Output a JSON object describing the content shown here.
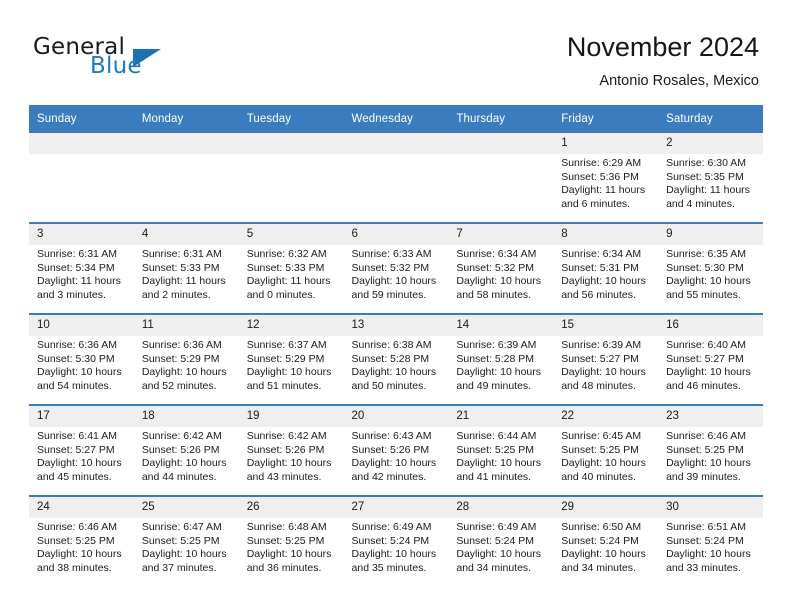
{
  "brand": {
    "word_one": "General",
    "word_two": "Blue",
    "logo_icon": "triangle-logo-icon"
  },
  "header": {
    "title": "November 2024",
    "subtitle": "Antonio Rosales, Mexico"
  },
  "calendar": {
    "weekday_headers": [
      "Sunday",
      "Monday",
      "Tuesday",
      "Wednesday",
      "Thursday",
      "Friday",
      "Saturday"
    ],
    "accent_color": "#3a7cbe",
    "daynum_band_color": "#efefef",
    "weeks": [
      [
        {
          "day": "",
          "empty": true,
          "lines": []
        },
        {
          "day": "",
          "empty": true,
          "lines": []
        },
        {
          "day": "",
          "empty": true,
          "lines": []
        },
        {
          "day": "",
          "empty": true,
          "lines": []
        },
        {
          "day": "",
          "empty": true,
          "lines": []
        },
        {
          "day": "1",
          "empty": false,
          "lines": [
            "Sunrise: 6:29 AM",
            "Sunset: 5:36 PM",
            "Daylight: 11 hours",
            "and 6 minutes."
          ]
        },
        {
          "day": "2",
          "empty": false,
          "lines": [
            "Sunrise: 6:30 AM",
            "Sunset: 5:35 PM",
            "Daylight: 11 hours",
            "and 4 minutes."
          ]
        }
      ],
      [
        {
          "day": "3",
          "empty": false,
          "lines": [
            "Sunrise: 6:31 AM",
            "Sunset: 5:34 PM",
            "Daylight: 11 hours",
            "and 3 minutes."
          ]
        },
        {
          "day": "4",
          "empty": false,
          "lines": [
            "Sunrise: 6:31 AM",
            "Sunset: 5:33 PM",
            "Daylight: 11 hours",
            "and 2 minutes."
          ]
        },
        {
          "day": "5",
          "empty": false,
          "lines": [
            "Sunrise: 6:32 AM",
            "Sunset: 5:33 PM",
            "Daylight: 11 hours",
            "and 0 minutes."
          ]
        },
        {
          "day": "6",
          "empty": false,
          "lines": [
            "Sunrise: 6:33 AM",
            "Sunset: 5:32 PM",
            "Daylight: 10 hours",
            "and 59 minutes."
          ]
        },
        {
          "day": "7",
          "empty": false,
          "lines": [
            "Sunrise: 6:34 AM",
            "Sunset: 5:32 PM",
            "Daylight: 10 hours",
            "and 58 minutes."
          ]
        },
        {
          "day": "8",
          "empty": false,
          "lines": [
            "Sunrise: 6:34 AM",
            "Sunset: 5:31 PM",
            "Daylight: 10 hours",
            "and 56 minutes."
          ]
        },
        {
          "day": "9",
          "empty": false,
          "lines": [
            "Sunrise: 6:35 AM",
            "Sunset: 5:30 PM",
            "Daylight: 10 hours",
            "and 55 minutes."
          ]
        }
      ],
      [
        {
          "day": "10",
          "empty": false,
          "lines": [
            "Sunrise: 6:36 AM",
            "Sunset: 5:30 PM",
            "Daylight: 10 hours",
            "and 54 minutes."
          ]
        },
        {
          "day": "11",
          "empty": false,
          "lines": [
            "Sunrise: 6:36 AM",
            "Sunset: 5:29 PM",
            "Daylight: 10 hours",
            "and 52 minutes."
          ]
        },
        {
          "day": "12",
          "empty": false,
          "lines": [
            "Sunrise: 6:37 AM",
            "Sunset: 5:29 PM",
            "Daylight: 10 hours",
            "and 51 minutes."
          ]
        },
        {
          "day": "13",
          "empty": false,
          "lines": [
            "Sunrise: 6:38 AM",
            "Sunset: 5:28 PM",
            "Daylight: 10 hours",
            "and 50 minutes."
          ]
        },
        {
          "day": "14",
          "empty": false,
          "lines": [
            "Sunrise: 6:39 AM",
            "Sunset: 5:28 PM",
            "Daylight: 10 hours",
            "and 49 minutes."
          ]
        },
        {
          "day": "15",
          "empty": false,
          "lines": [
            "Sunrise: 6:39 AM",
            "Sunset: 5:27 PM",
            "Daylight: 10 hours",
            "and 48 minutes."
          ]
        },
        {
          "day": "16",
          "empty": false,
          "lines": [
            "Sunrise: 6:40 AM",
            "Sunset: 5:27 PM",
            "Daylight: 10 hours",
            "and 46 minutes."
          ]
        }
      ],
      [
        {
          "day": "17",
          "empty": false,
          "lines": [
            "Sunrise: 6:41 AM",
            "Sunset: 5:27 PM",
            "Daylight: 10 hours",
            "and 45 minutes."
          ]
        },
        {
          "day": "18",
          "empty": false,
          "lines": [
            "Sunrise: 6:42 AM",
            "Sunset: 5:26 PM",
            "Daylight: 10 hours",
            "and 44 minutes."
          ]
        },
        {
          "day": "19",
          "empty": false,
          "lines": [
            "Sunrise: 6:42 AM",
            "Sunset: 5:26 PM",
            "Daylight: 10 hours",
            "and 43 minutes."
          ]
        },
        {
          "day": "20",
          "empty": false,
          "lines": [
            "Sunrise: 6:43 AM",
            "Sunset: 5:26 PM",
            "Daylight: 10 hours",
            "and 42 minutes."
          ]
        },
        {
          "day": "21",
          "empty": false,
          "lines": [
            "Sunrise: 6:44 AM",
            "Sunset: 5:25 PM",
            "Daylight: 10 hours",
            "and 41 minutes."
          ]
        },
        {
          "day": "22",
          "empty": false,
          "lines": [
            "Sunrise: 6:45 AM",
            "Sunset: 5:25 PM",
            "Daylight: 10 hours",
            "and 40 minutes."
          ]
        },
        {
          "day": "23",
          "empty": false,
          "lines": [
            "Sunrise: 6:46 AM",
            "Sunset: 5:25 PM",
            "Daylight: 10 hours",
            "and 39 minutes."
          ]
        }
      ],
      [
        {
          "day": "24",
          "empty": false,
          "lines": [
            "Sunrise: 6:46 AM",
            "Sunset: 5:25 PM",
            "Daylight: 10 hours",
            "and 38 minutes."
          ]
        },
        {
          "day": "25",
          "empty": false,
          "lines": [
            "Sunrise: 6:47 AM",
            "Sunset: 5:25 PM",
            "Daylight: 10 hours",
            "and 37 minutes."
          ]
        },
        {
          "day": "26",
          "empty": false,
          "lines": [
            "Sunrise: 6:48 AM",
            "Sunset: 5:25 PM",
            "Daylight: 10 hours",
            "and 36 minutes."
          ]
        },
        {
          "day": "27",
          "empty": false,
          "lines": [
            "Sunrise: 6:49 AM",
            "Sunset: 5:24 PM",
            "Daylight: 10 hours",
            "and 35 minutes."
          ]
        },
        {
          "day": "28",
          "empty": false,
          "lines": [
            "Sunrise: 6:49 AM",
            "Sunset: 5:24 PM",
            "Daylight: 10 hours",
            "and 34 minutes."
          ]
        },
        {
          "day": "29",
          "empty": false,
          "lines": [
            "Sunrise: 6:50 AM",
            "Sunset: 5:24 PM",
            "Daylight: 10 hours",
            "and 34 minutes."
          ]
        },
        {
          "day": "30",
          "empty": false,
          "lines": [
            "Sunrise: 6:51 AM",
            "Sunset: 5:24 PM",
            "Daylight: 10 hours",
            "and 33 minutes."
          ]
        }
      ]
    ]
  }
}
